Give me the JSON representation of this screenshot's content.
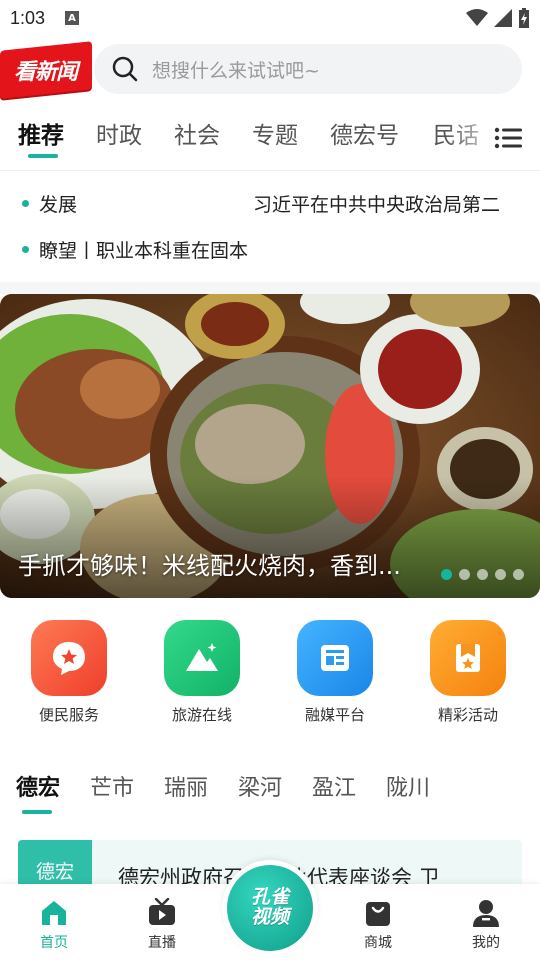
{
  "status_bar": {
    "time": "1:03",
    "notification_glyph": "A"
  },
  "header": {
    "logo_text": "看新闻",
    "search_placeholder": "想搜什么来试试吧~"
  },
  "tabs": [
    "推荐",
    "时政",
    "社会",
    "专题",
    "德宏号",
    "民话"
  ],
  "ticker": {
    "row1_left": "发展",
    "row1_right": "习近平在中共中央政治局第二",
    "row2": "瞭望丨职业本科重在固本"
  },
  "banner": {
    "caption": "手抓才够味！米线配火烧肉，香到...",
    "dot_count": 5,
    "active_dot": 0
  },
  "services": [
    {
      "label": "便民服务",
      "color": "#f45a3a",
      "icon": "service-star-icon"
    },
    {
      "label": "旅游在线",
      "color": "#1fc47a",
      "icon": "mountain-icon"
    },
    {
      "label": "融媒平台",
      "color": "#2b9cf0",
      "icon": "newspaper-icon"
    },
    {
      "label": "精彩活动",
      "color": "#f7941d",
      "icon": "bookmark-star-icon"
    }
  ],
  "region_tabs": [
    "德宏",
    "芒市",
    "瑞丽",
    "梁河",
    "盈江",
    "陇川"
  ],
  "news_card": {
    "badge": "德宏",
    "title": "德宏州政府召开企业代表座谈会  卫"
  },
  "bottom_nav": {
    "home": "首页",
    "live": "直播",
    "center": "孔雀视频",
    "shop": "商城",
    "mine": "我的"
  },
  "colors": {
    "accent": "#18b39b",
    "brand_red": "#e4141b"
  }
}
